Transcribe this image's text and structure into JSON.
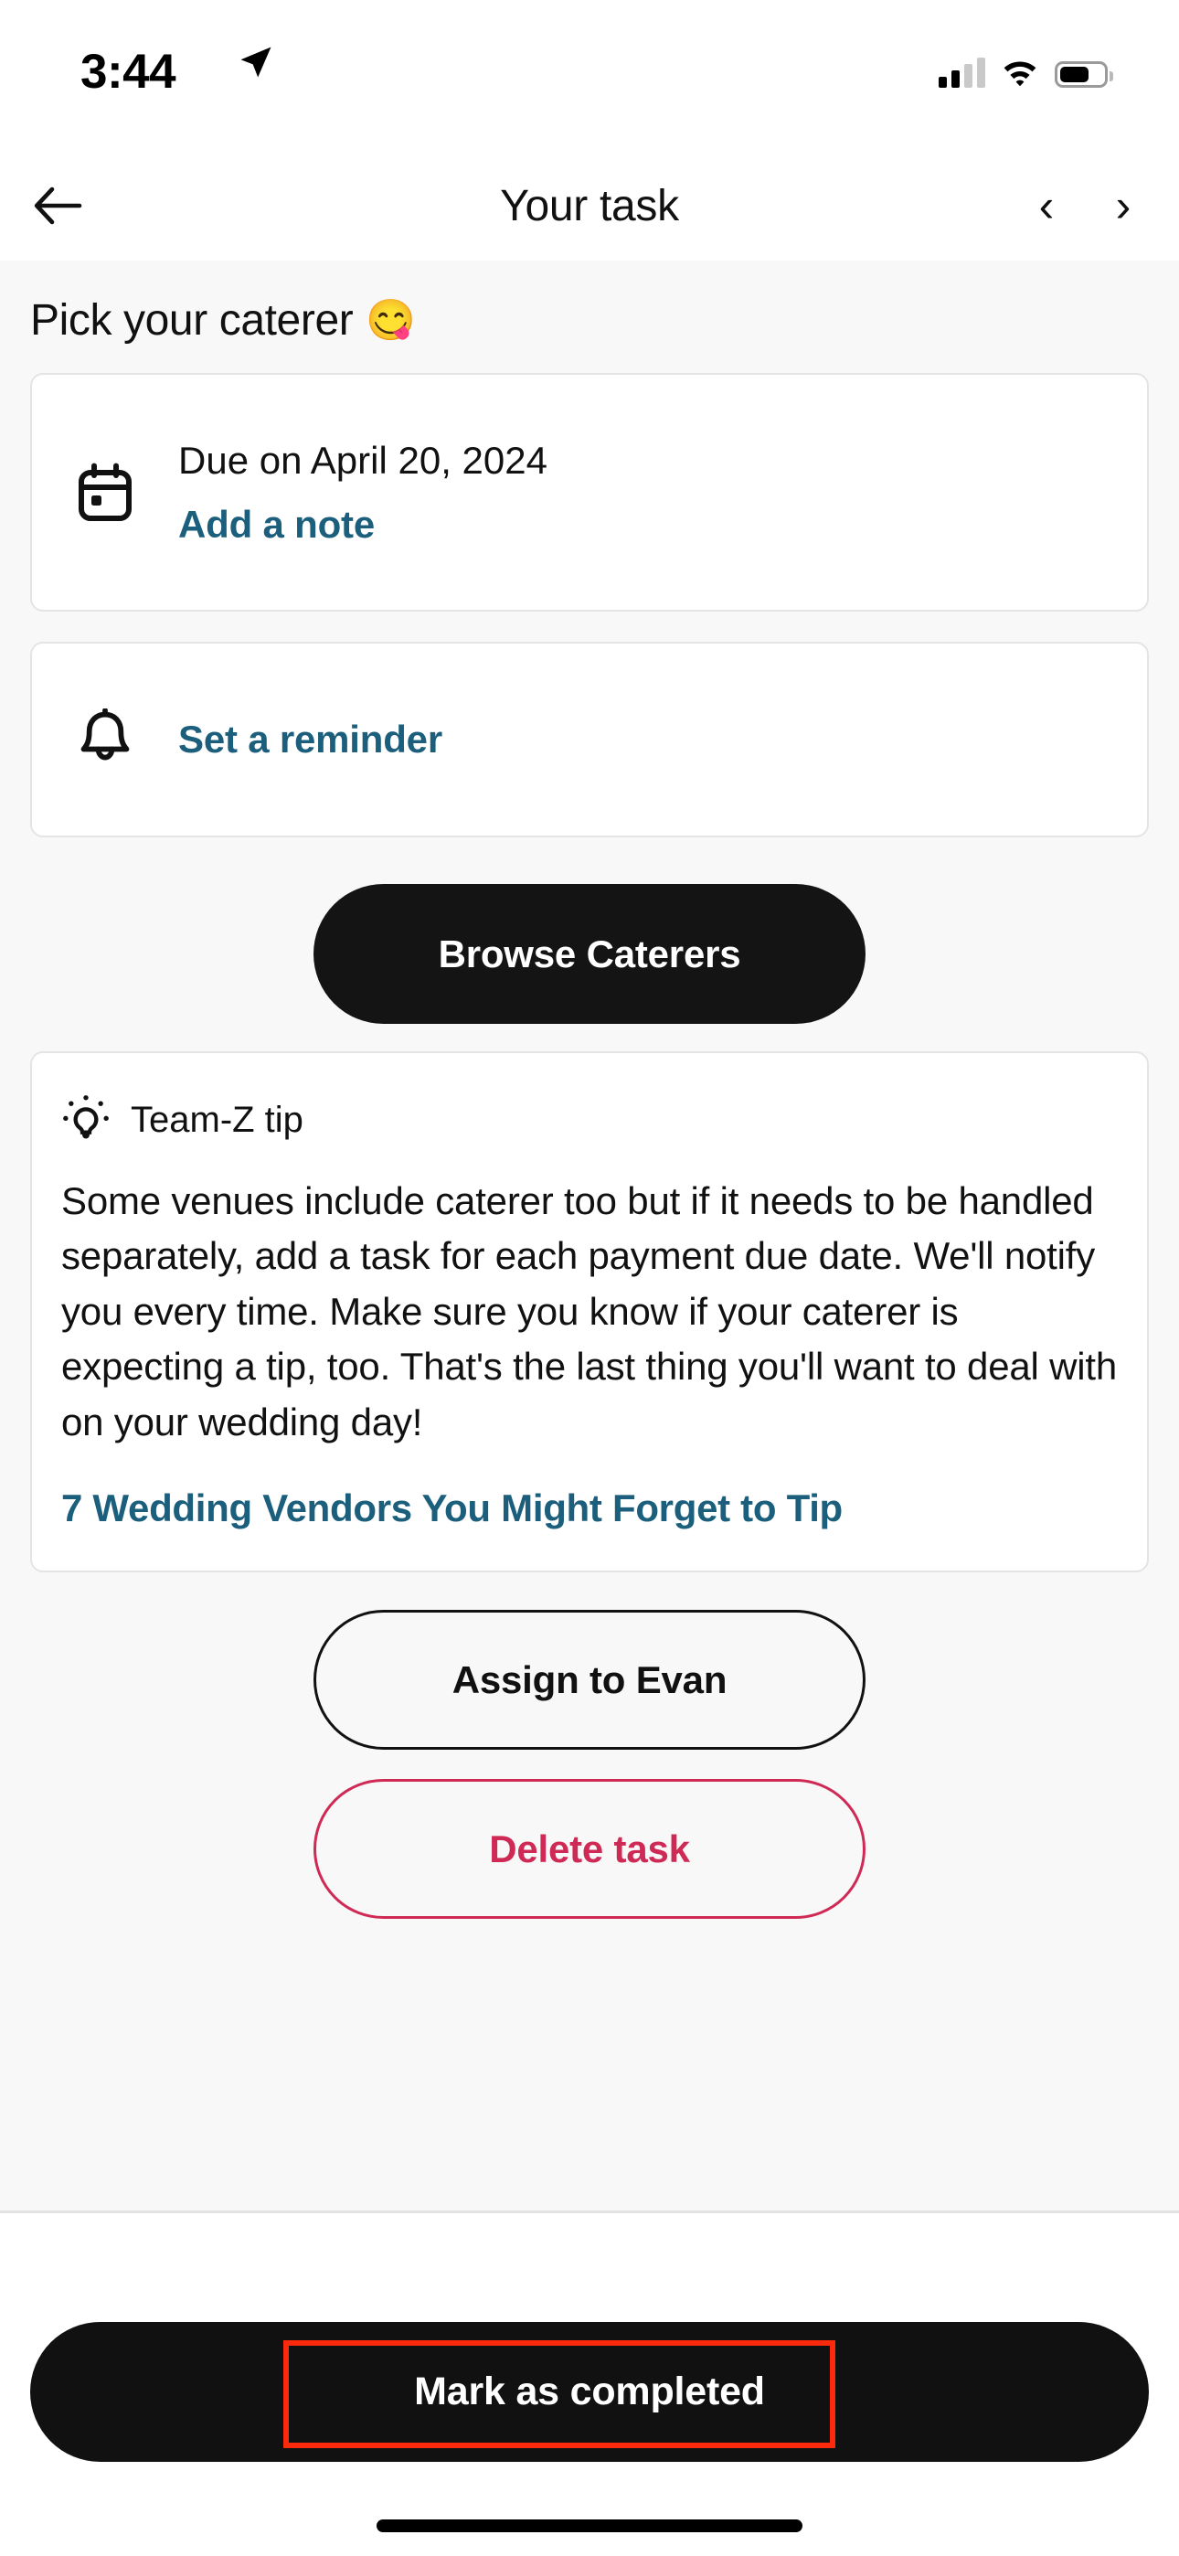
{
  "status_bar": {
    "time": "3:44",
    "location_icon": "location-arrow-icon",
    "cellular_icon": "cellular-signal-icon",
    "cellular_bars_filled": 2,
    "cellular_bars_total": 4,
    "wifi_icon": "wifi-icon",
    "battery_icon": "battery-icon",
    "battery_level_percent": 60
  },
  "nav": {
    "back_icon": "arrow-left-icon",
    "title": "Your task",
    "prev_icon": "chevron-left-icon",
    "next_icon": "chevron-right-icon"
  },
  "task": {
    "title": "Pick your caterer",
    "title_emoji": "😋",
    "due_card": {
      "icon": "calendar-icon",
      "due_label": "Due on April 20, 2024",
      "note_link": "Add a note"
    },
    "reminder_card": {
      "icon": "bell-icon",
      "label": "Set a reminder"
    },
    "browse_button": "Browse Caterers",
    "tip": {
      "icon": "lightbulb-icon",
      "heading": "Team-Z tip",
      "body": "Some venues include caterer too but if it needs to be handled separately, add a task for each payment due date. We'll notify you every time. Make sure you know if your caterer is expecting a tip, too. That's the last thing you'll want to deal with on your wedding day!",
      "link": "7 Wedding Vendors You Might Forget to Tip"
    },
    "assign_button": "Assign to Evan",
    "delete_button": "Delete task"
  },
  "bottom_bar": {
    "complete_button": "Mark as completed"
  },
  "colors": {
    "link_blue": "#1b5f7d",
    "delete_red": "#cf2a55",
    "primary_black": "#141414",
    "annotation_red": "#fc2a0c",
    "page_background": "#f8f8f8"
  }
}
